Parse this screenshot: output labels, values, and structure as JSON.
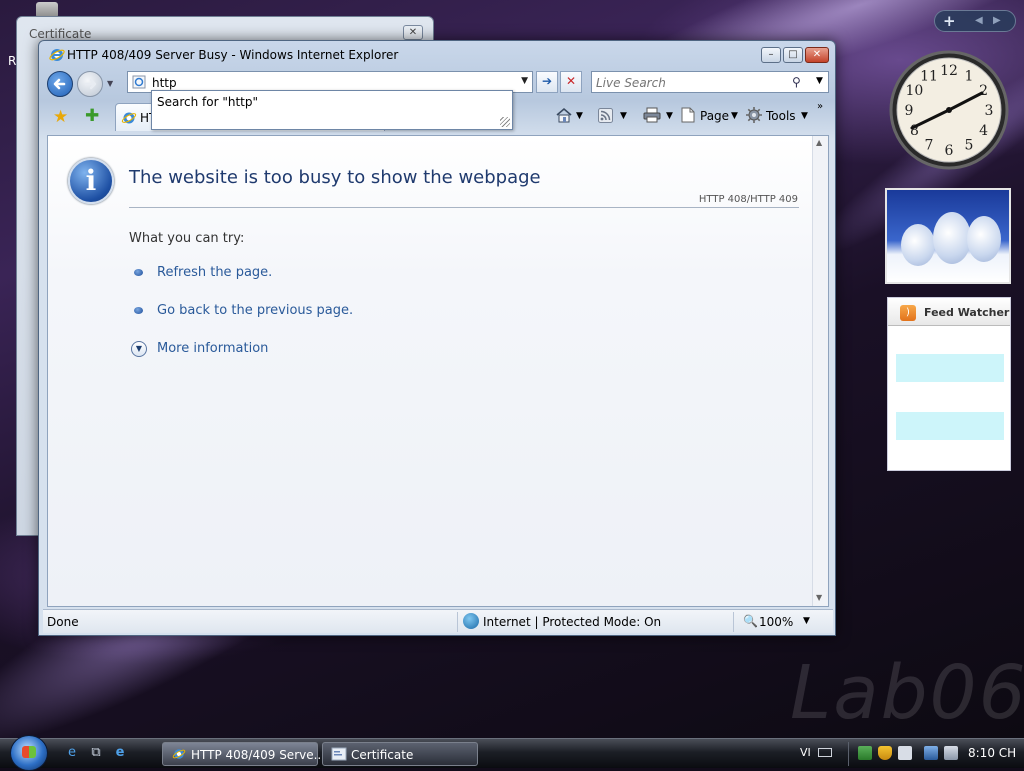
{
  "desktop": {
    "watermark": "Lab06",
    "icon_label": "R"
  },
  "certificate_window": {
    "title": "Certificate",
    "close_glyph": "✕"
  },
  "ie": {
    "window_title": "HTTP 408/409 Server Busy - Windows Internet Explorer",
    "address": "http",
    "search_placeholder": "Live Search",
    "autocomplete": "Search for \"http\"",
    "tab_label": "HTTP 408/409 Server Busy",
    "tab_label_visible": "HTT",
    "commands": {
      "page": "Page",
      "tools": "Tools"
    },
    "icons": {
      "back": "back-arrow-icon",
      "forward": "forward-arrow-icon",
      "go": "go-arrow-icon",
      "stop": "stop-x-icon",
      "home": "home-icon",
      "feeds": "rss-feed-icon",
      "print": "printer-icon",
      "favorites": "star-icon",
      "add_favorites": "add-favorite-icon"
    },
    "content": {
      "title": "The website is too busy to show the webpage",
      "error_code": "HTTP 408/HTTP 409",
      "try_heading": "What you can try:",
      "actions": [
        "Refresh the page.",
        "Go back to the previous page.",
        "More information"
      ]
    },
    "status": {
      "text": "Done",
      "zone": "Internet | Protected Mode: On",
      "zoom": "100%"
    },
    "colors": {
      "title_text": "#1f3a6e",
      "link": "#2a5a9a"
    }
  },
  "sidebar": {
    "feed_title": "Feed Watcher",
    "clock_numbers": [
      "12",
      "1",
      "2",
      "3",
      "4",
      "5",
      "6",
      "7",
      "8",
      "9",
      "10",
      "11"
    ]
  },
  "taskbar": {
    "tasks": [
      {
        "label": "HTTP 408/409 Serve...",
        "active": true
      },
      {
        "label": "Certificate",
        "active": false
      }
    ],
    "language": "VI",
    "time": "8:10 CH"
  }
}
